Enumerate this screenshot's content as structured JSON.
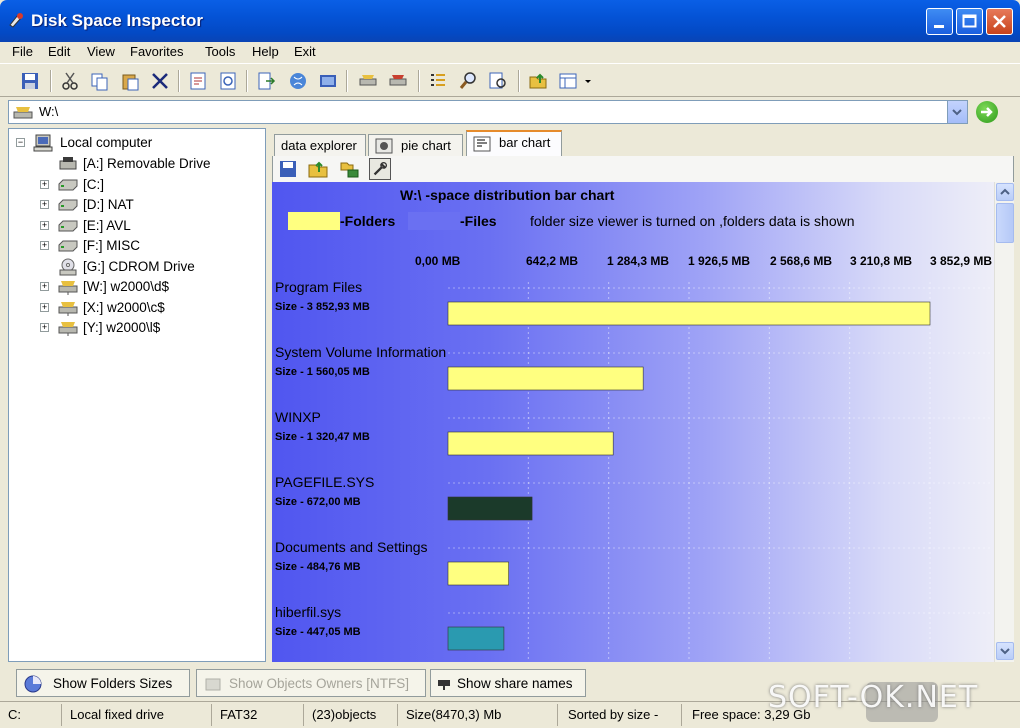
{
  "window": {
    "title": "Disk Space Inspector"
  },
  "menu": [
    "File",
    "Edit",
    "View",
    "Favorites",
    "Tools",
    "Help",
    "Exit"
  ],
  "address": {
    "value": "W:\\"
  },
  "tree": {
    "root": "Local computer",
    "items": [
      {
        "label": "[A:] Removable Drive",
        "icon": "floppy-drive-icon"
      },
      {
        "label": "[C:]",
        "icon": "hard-drive-icon"
      },
      {
        "label": "[D:] NAT",
        "icon": "hard-drive-icon"
      },
      {
        "label": "[E:] AVL",
        "icon": "hard-drive-icon"
      },
      {
        "label": "[F:] MISC",
        "icon": "hard-drive-icon"
      },
      {
        "label": "[G:] CDROM Drive",
        "icon": "cdrom-icon"
      },
      {
        "label": "[W:] w2000\\d$",
        "icon": "network-drive-icon"
      },
      {
        "label": "[X:] w2000\\c$",
        "icon": "network-drive-icon"
      },
      {
        "label": "[Y:] w2000\\l$",
        "icon": "network-drive-icon"
      }
    ]
  },
  "tabs": [
    "data explorer",
    "pie chart",
    "bar chart"
  ],
  "active_tab": "bar chart",
  "chart_data": {
    "type": "bar",
    "title": "W:\\   -space distribution bar chart",
    "legend": [
      {
        "label": "-Folders",
        "color": "#ffff80"
      },
      {
        "label": "-Files",
        "color": "#6a70f2"
      }
    ],
    "note": "folder size viewer is turned on ,folders data is shown",
    "x_ticks": [
      "0,00 MB",
      "642,2 MB",
      "1 284,3 MB",
      "1 926,5 MB",
      "2 568,6 MB",
      "3 210,8 MB",
      "3 852,9 MB"
    ],
    "xlim": [
      0,
      3852.9
    ],
    "unit": "MB",
    "items": [
      {
        "name": "Program Files",
        "size_label": "Size - 3 852,93 MB",
        "value": 3852.93,
        "color": "#ffff80"
      },
      {
        "name": "System Volume Information",
        "size_label": "Size - 1 560,05 MB",
        "value": 1560.05,
        "color": "#ffff80"
      },
      {
        "name": "WINXP",
        "size_label": "Size - 1 320,47 MB",
        "value": 1320.47,
        "color": "#ffff80"
      },
      {
        "name": "PAGEFILE.SYS",
        "size_label": "Size - 672,00 MB",
        "value": 672.0,
        "color": "#1b3a2a"
      },
      {
        "name": "Documents and Settings",
        "size_label": "Size - 484,76 MB",
        "value": 484.76,
        "color": "#ffff80"
      },
      {
        "name": "hiberfil.sys",
        "size_label": "Size - 447,05 MB",
        "value": 447.05,
        "color": "#2a9ab0"
      }
    ]
  },
  "bottom_buttons": [
    {
      "label": "Show Folders Sizes",
      "enabled": true
    },
    {
      "label": "Show Objects Owners [NTFS]",
      "enabled": false
    },
    {
      "label": "Show share names",
      "enabled": true
    }
  ],
  "status": [
    "C:",
    "Local fixed drive",
    "FAT32",
    "(23)objects",
    "Size(8470,3) Mb",
    "Sorted by size -",
    "Free space: 3,29 Gb"
  ],
  "watermark": "SOFT-OK.NET"
}
